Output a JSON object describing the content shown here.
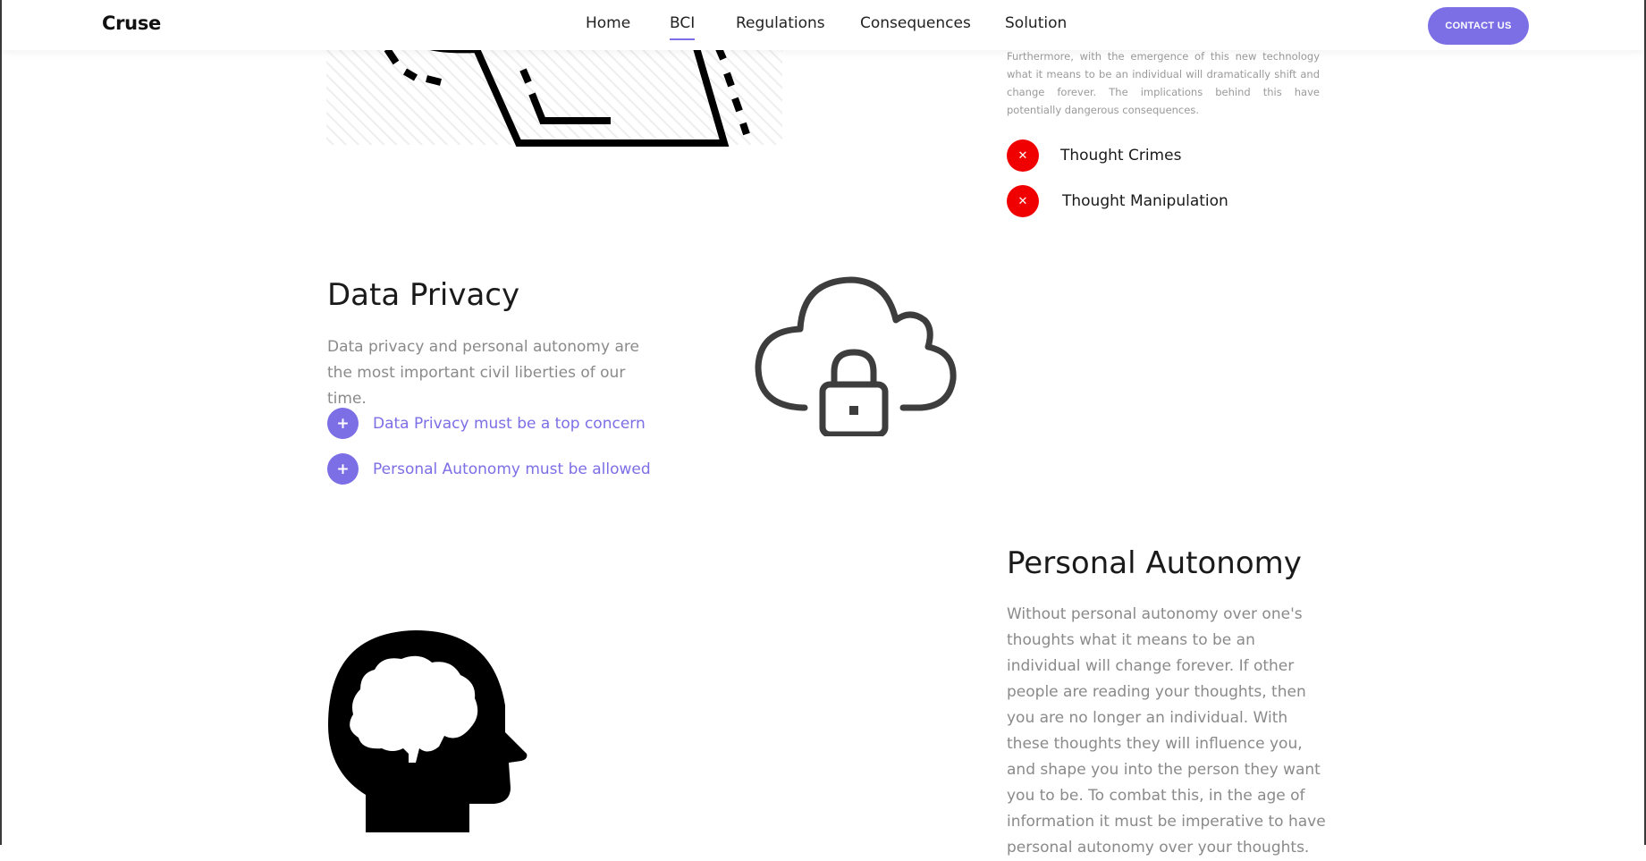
{
  "nav": {
    "brand": "Cruse",
    "links": [
      "Home",
      "BCI",
      "Regulations",
      "Consequences",
      "Solution"
    ],
    "active": "BCI",
    "contact_label": "CONTACT US"
  },
  "consequences": {
    "paragraph": "Furthermore, with the emergence of this new technology what it means to be an individual will dramatically shift and change forever. The implications behind this have potentially dangerous consequences.",
    "items": [
      "Thought Crimes",
      "Thought Manipulation"
    ],
    "item_icon": "close-icon"
  },
  "data_privacy": {
    "title": "Data Privacy",
    "text": "Data privacy and personal autonomy are the most important civil liberties of our time.",
    "items": [
      "Data Privacy must be a top concern",
      "Personal Autonomy must be allowed"
    ],
    "item_icon": "plus-icon",
    "illustration_icon": "cloud-lock-icon"
  },
  "personal_autonomy": {
    "title": "Personal Autonomy",
    "text": "Without personal autonomy over one's thoughts what it means to be an individual will change forever. If other people are reading your thoughts, then you are no longer an individual. With these thoughts they will influence you, and shape you into the person they want you to be. To combat this, in the age of information it must be imperative to have personal autonomy over your thoughts.",
    "illustration_icon": "head-brain-icon"
  },
  "colors": {
    "accent": "#7c6fe6",
    "danger": "#f00000",
    "muted_text": "#8a8a8a"
  }
}
